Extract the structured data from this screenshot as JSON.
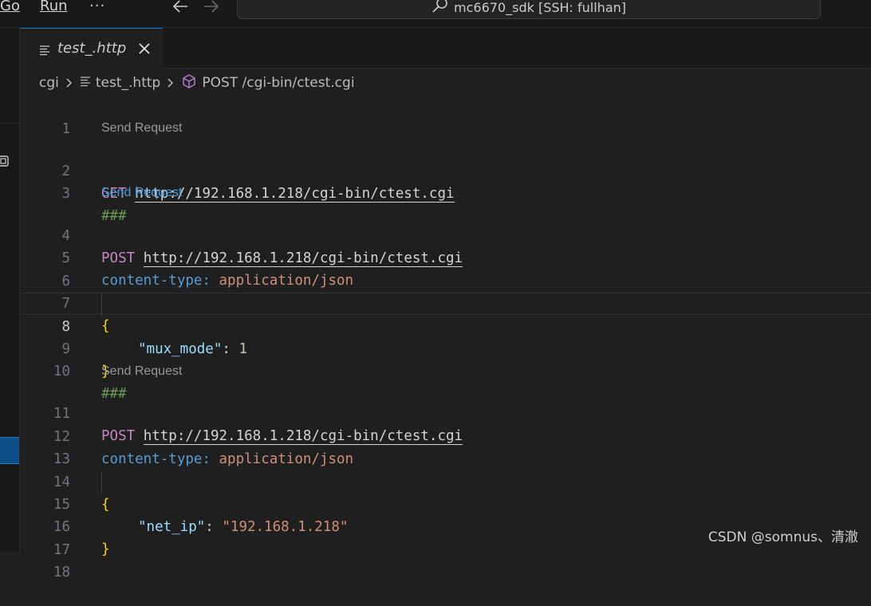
{
  "menu": {
    "go": "Go",
    "run": "Run",
    "more": "···"
  },
  "command_center": {
    "title": "mc6670_sdk [SSH: fullhan]"
  },
  "tab": {
    "label": "test_.http"
  },
  "breadcrumb": {
    "folder": "cgi",
    "file": "test_.http",
    "symbol": "POST /cgi-bin/ctest.cgi"
  },
  "editor": {
    "codelens": "Send Request",
    "lines": {
      "n1": "1",
      "n2": "2",
      "n3": "3",
      "n4": "4",
      "n5": "5",
      "n6": "6",
      "n7": "7",
      "n8": "8",
      "n9": "9",
      "n10": "10",
      "n11": "11",
      "n12": "12",
      "n13": "13",
      "n14": "14",
      "n15": "15",
      "n16": "16",
      "n17": "17",
      "n18": "18"
    },
    "req1": {
      "method": "GET",
      "url": "http://192.168.1.218/cgi-bin/ctest.cgi"
    },
    "separator": "###",
    "req2": {
      "method": "POST",
      "url": "http://192.168.1.218/cgi-bin/ctest.cgi",
      "header_name": "content-type:",
      "header_value": "application/json",
      "open": "{",
      "key": "\"mux_mode\"",
      "colon": ": ",
      "value": "1",
      "close": "}"
    },
    "req3": {
      "method": "POST",
      "url": "http://192.168.1.218/cgi-bin/ctest.cgi",
      "header_name": "content-type:",
      "header_value": "application/json",
      "open": "{",
      "key": "\"net_ip\"",
      "colon": ": ",
      "value": "\"192.168.1.218\"",
      "close": "}"
    }
  },
  "watermark": "CSDN @somnus、清澈"
}
